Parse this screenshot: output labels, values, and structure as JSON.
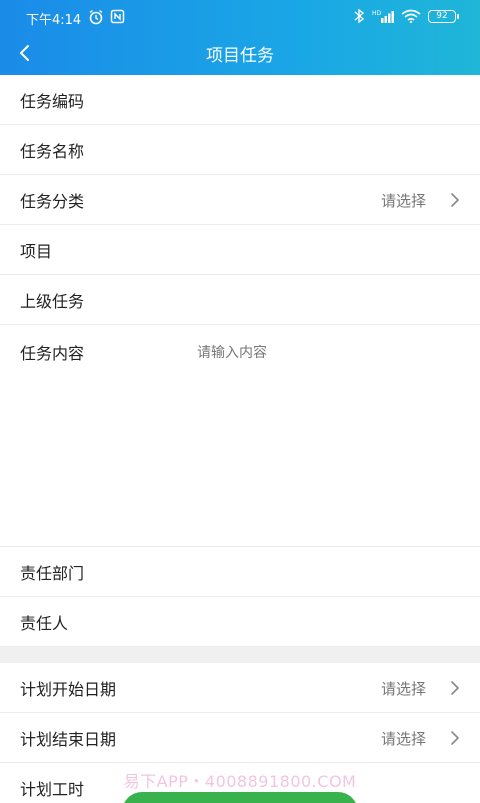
{
  "status_bar": {
    "time": "下午4:14",
    "battery": "92"
  },
  "nav": {
    "title": "项目任务"
  },
  "form": {
    "task_code_label": "任务编码",
    "task_name_label": "任务名称",
    "task_category_label": "任务分类",
    "task_category_value": "请选择",
    "project_label": "项目",
    "parent_task_label": "上级任务",
    "task_content_label": "任务内容",
    "task_content_placeholder": "请输入内容",
    "department_label": "责任部门",
    "responsible_person_label": "责任人",
    "plan_start_label": "计划开始日期",
    "plan_start_value": "请选择",
    "plan_end_label": "计划结束日期",
    "plan_end_value": "请选择",
    "plan_hours_label": "计划工时"
  },
  "watermark": "易下APP・4008891800.COM",
  "colors": {
    "header_start": "#1a8be8",
    "header_end": "#1fb6d8",
    "submit_green": "#37b24d"
  }
}
